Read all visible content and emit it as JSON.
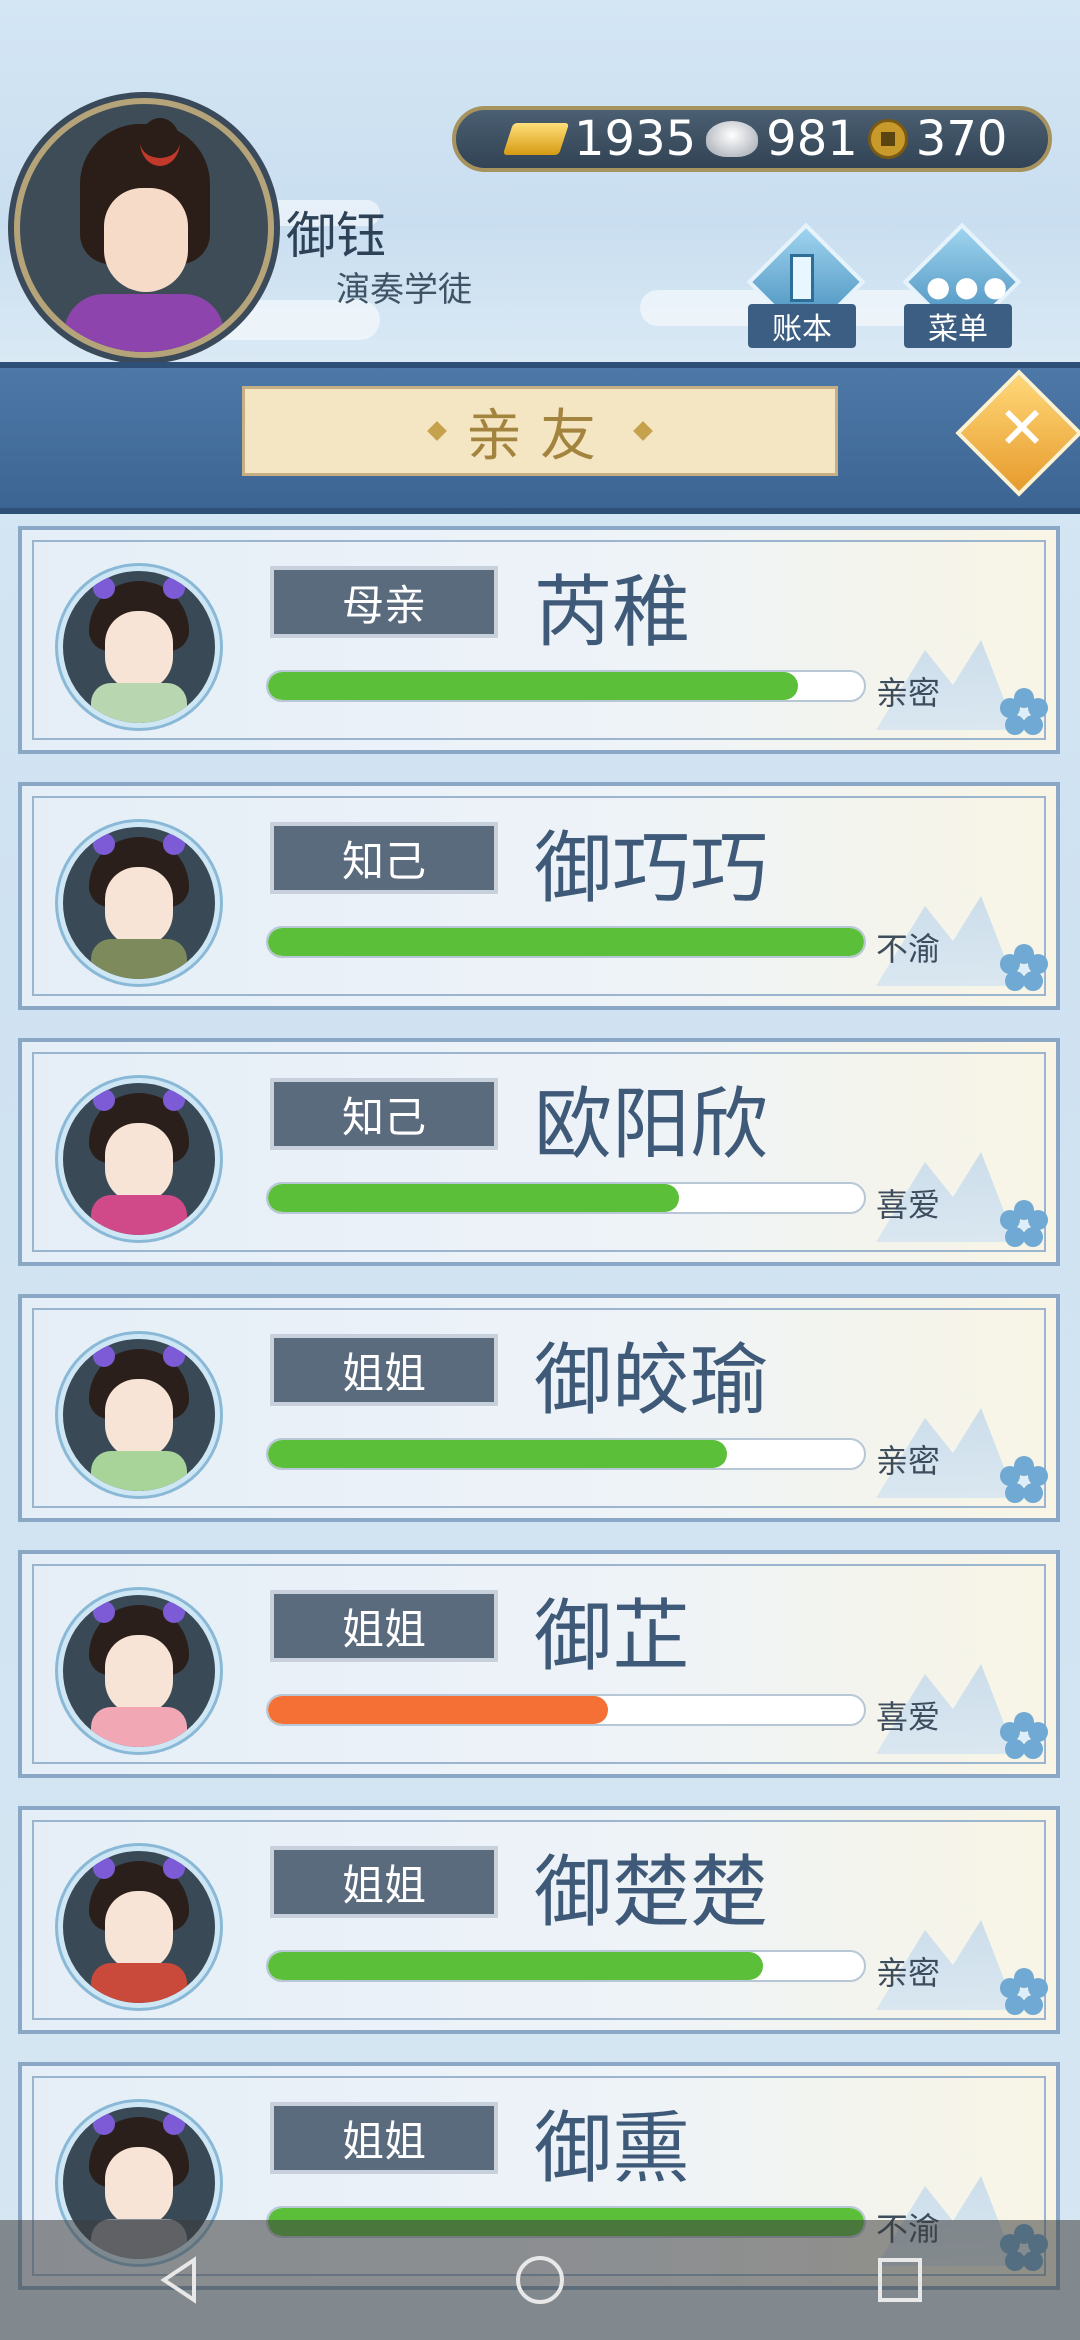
{
  "player": {
    "name": "御钰",
    "title": "演奏学徒"
  },
  "currency": {
    "gold": "1935",
    "silver": "981",
    "coins": "370"
  },
  "buttons": {
    "ledger_label": "账本",
    "menu_label": "菜单"
  },
  "page": {
    "title": "亲友"
  },
  "relatives": [
    {
      "relation": "母亲",
      "name": "芮稚",
      "status": "亲密",
      "bar_fraction": 0.89,
      "bar_color": "#5bbf3a",
      "robe_color": "#b8d7b0"
    },
    {
      "relation": "知己",
      "name": "御巧巧",
      "status": "不渝",
      "bar_fraction": 1.0,
      "bar_color": "#5bbf3a",
      "robe_color": "#7d8a5c"
    },
    {
      "relation": "知己",
      "name": "欧阳欣",
      "status": "喜爱",
      "bar_fraction": 0.69,
      "bar_color": "#5bbf3a",
      "robe_color": "#d04a8a"
    },
    {
      "relation": "姐姐",
      "name": "御皎瑜",
      "status": "亲密",
      "bar_fraction": 0.77,
      "bar_color": "#5bbf3a",
      "robe_color": "#a8d49a"
    },
    {
      "relation": "姐姐",
      "name": "御芷",
      "status": "喜爱",
      "bar_fraction": 0.57,
      "bar_color": "#f47035",
      "robe_color": "#f2a7b5"
    },
    {
      "relation": "姐姐",
      "name": "御楚楚",
      "status": "亲密",
      "bar_fraction": 0.83,
      "bar_color": "#5bbf3a",
      "robe_color": "#c94a3a"
    },
    {
      "relation": "姐姐",
      "name": "御熏",
      "status": "不渝",
      "bar_fraction": 1.0,
      "bar_color": "#5bbf3a",
      "robe_color": "#8a8f95"
    }
  ]
}
